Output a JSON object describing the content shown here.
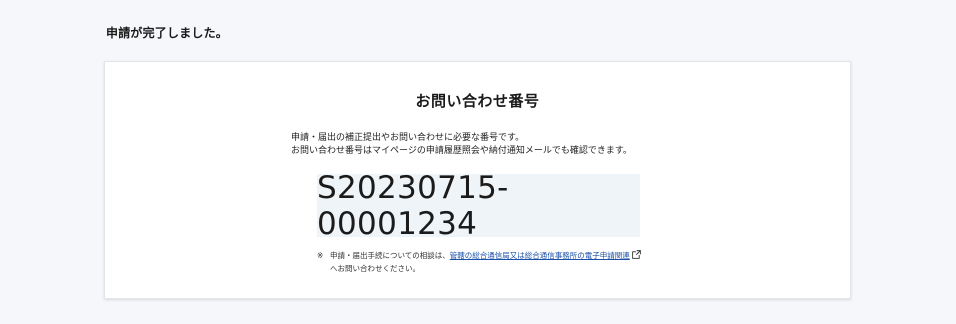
{
  "page": {
    "heading": "申請が完了しました。"
  },
  "card": {
    "title": "お問い合わせ番号",
    "description": [
      "申請・届出の補正提出やお問い合わせに必要な番号です。",
      "お問い合わせ番号はマイページの申請履歴照会や納付通知メールでも確認できます。"
    ],
    "inquiry_number": "S20230715-00001234",
    "note": {
      "mark": "※",
      "prefix": "申請・届出手続についての相談は、",
      "link_text": "管轄の総合通信局又は総合通信事務所の電子申請関連",
      "link_icon": "external-link-icon",
      "suffix": "へお問い合わせください。"
    }
  },
  "colors": {
    "page_background": "#f5f7fb",
    "number_box_background": "#eef4f8",
    "link": "#1a4fa8"
  }
}
